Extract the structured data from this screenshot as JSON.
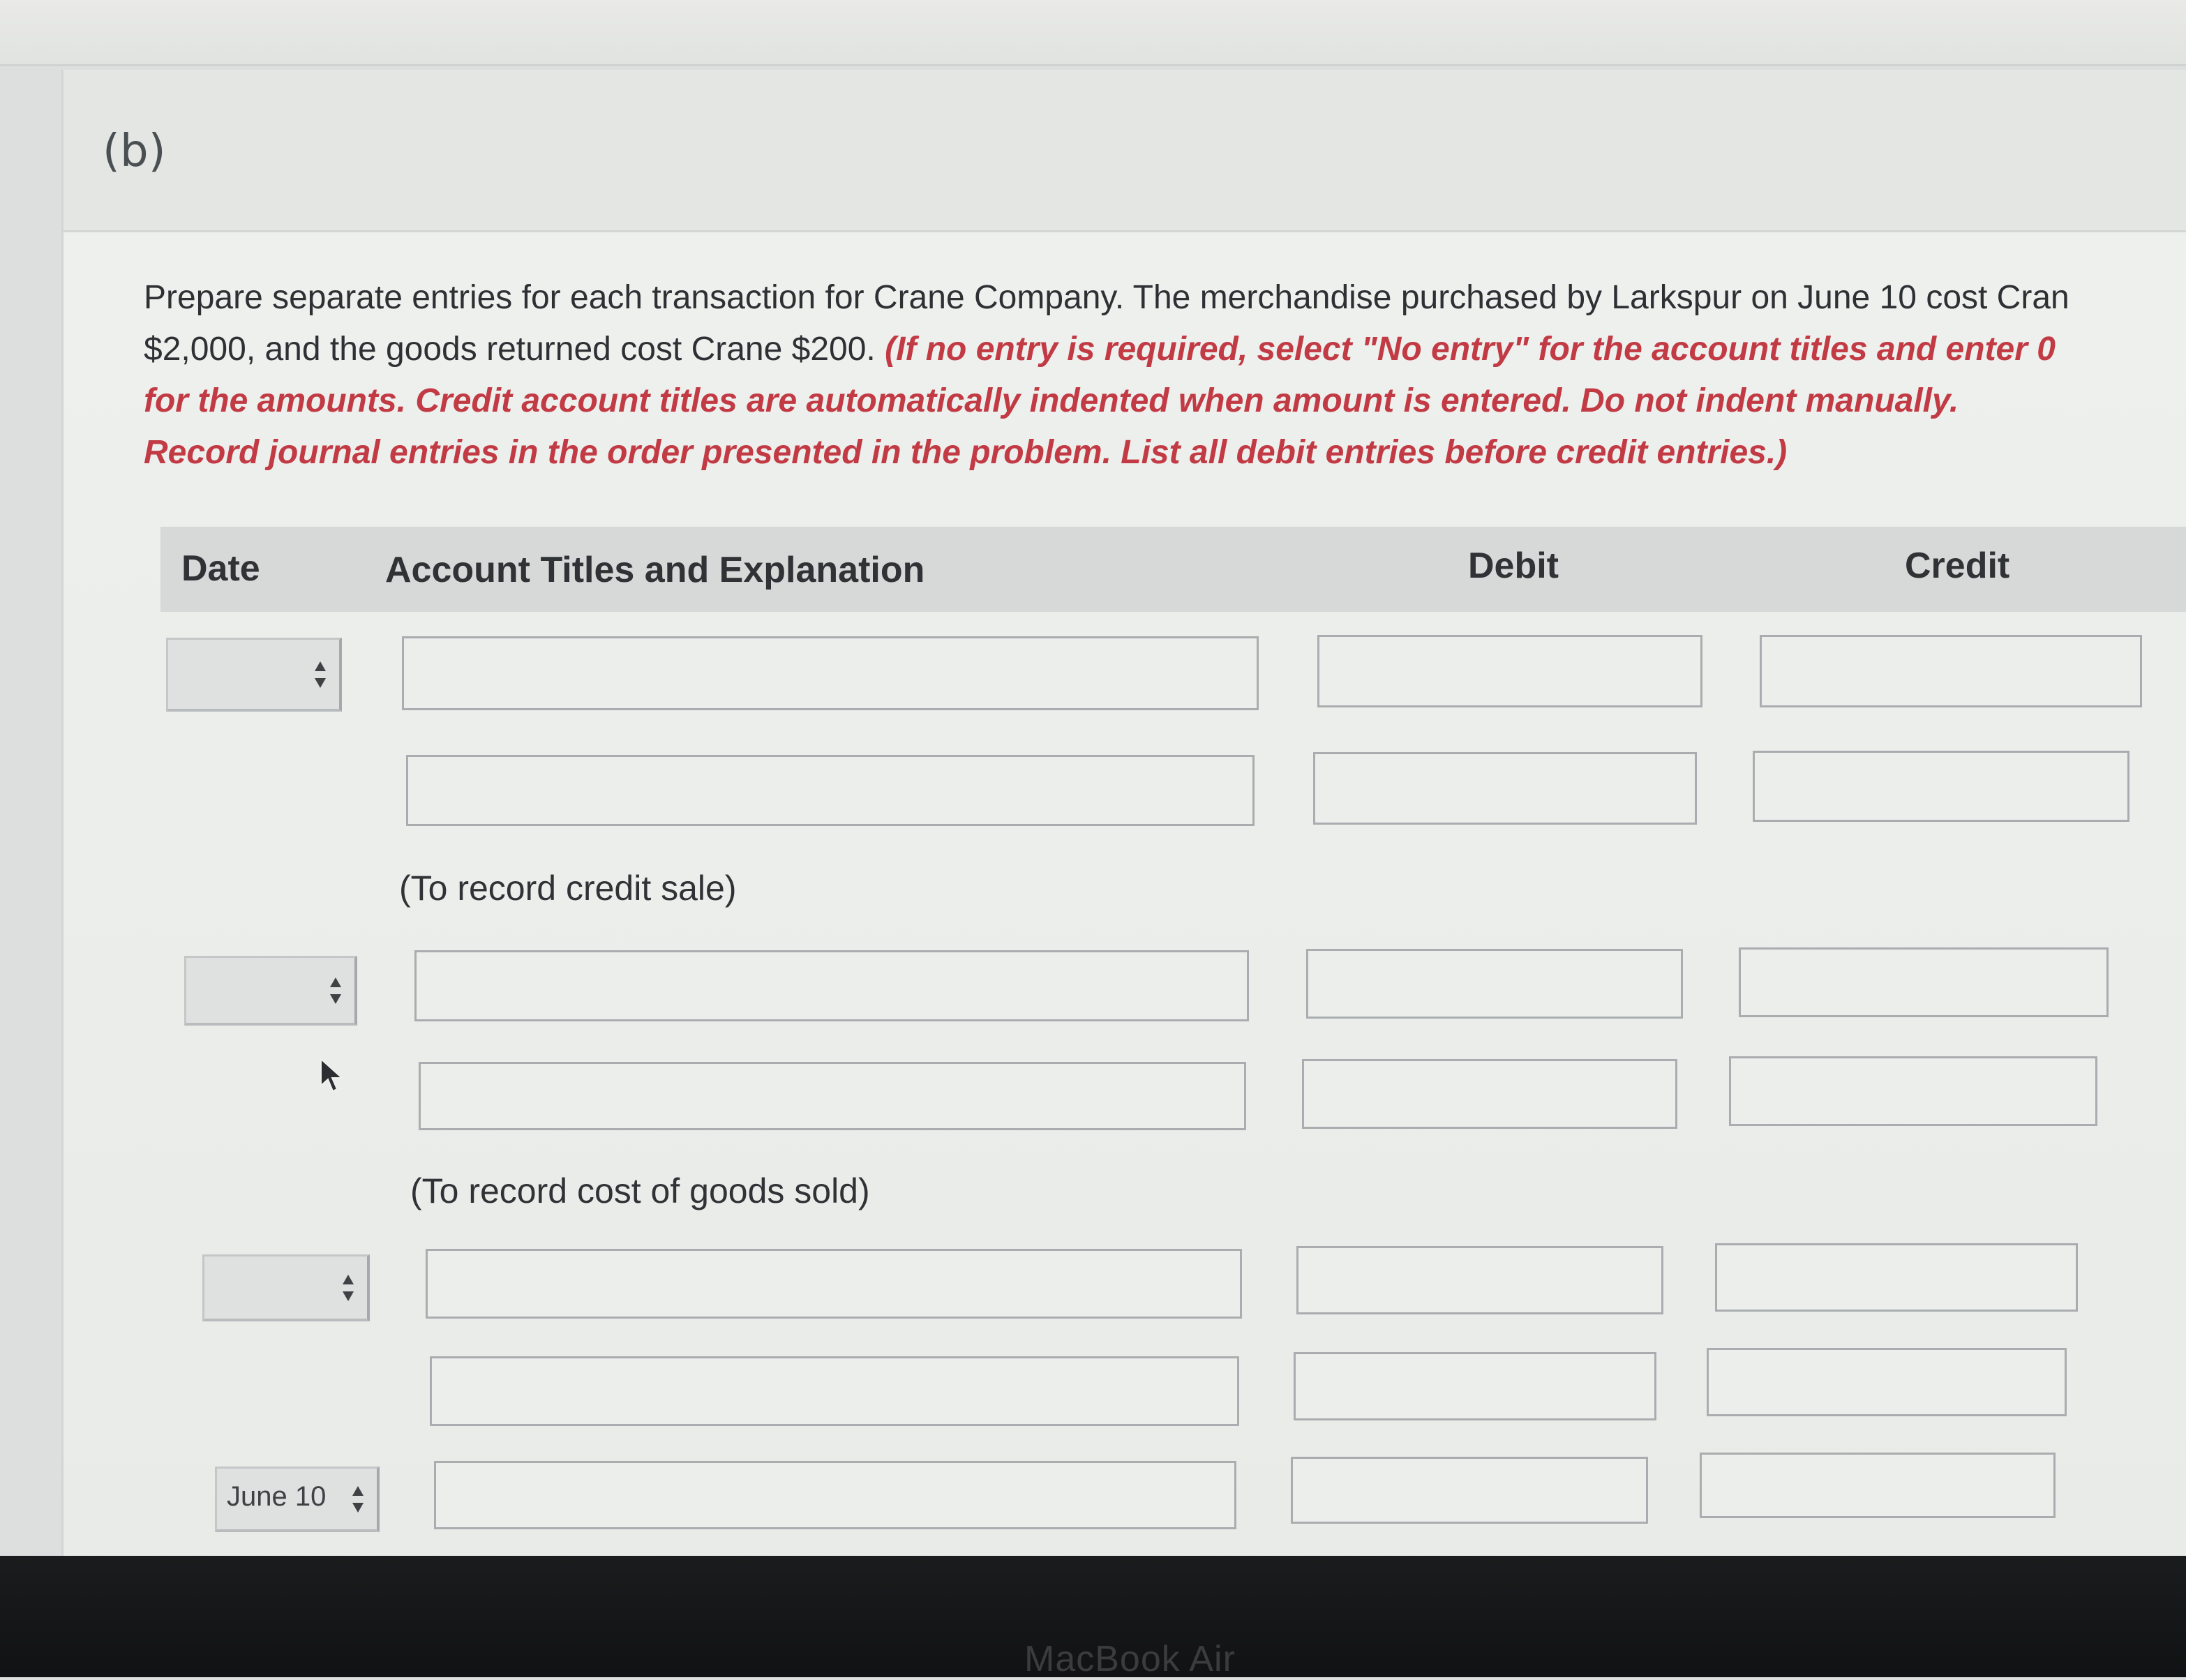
{
  "section": {
    "label": "(b)"
  },
  "instructions": {
    "line1": "Prepare separate entries for each transaction for Crane Company. The merchandise purchased by Larkspur on June 10 cost Cran",
    "line2_plain": "$2,000, and the goods returned cost Crane $200. ",
    "line2_note": "(If no entry is required, select \"No entry\" for the account titles and enter 0",
    "line3_note": "for the amounts. Credit account titles are automatically indented when amount is entered. Do not indent manually.",
    "line4_note": "Record journal entries in the order presented in the problem. List all debit entries before credit entries.)"
  },
  "table": {
    "headers": {
      "date": "Date",
      "account": "Account Titles and Explanation",
      "debit": "Debit",
      "credit": "Credit"
    },
    "entries": [
      {
        "date_value": "",
        "memo": "(To record credit sale)"
      },
      {
        "date_value": "",
        "memo": "(To record cost of goods sold)"
      },
      {
        "date_value": "",
        "memo": ""
      },
      {
        "date_value": "June 10",
        "memo": ""
      }
    ]
  },
  "device": {
    "brand": "MacBook Air"
  },
  "icons": {
    "select_arrows": "up-down-arrows-icon",
    "pointer": "mouse-pointer-icon"
  }
}
